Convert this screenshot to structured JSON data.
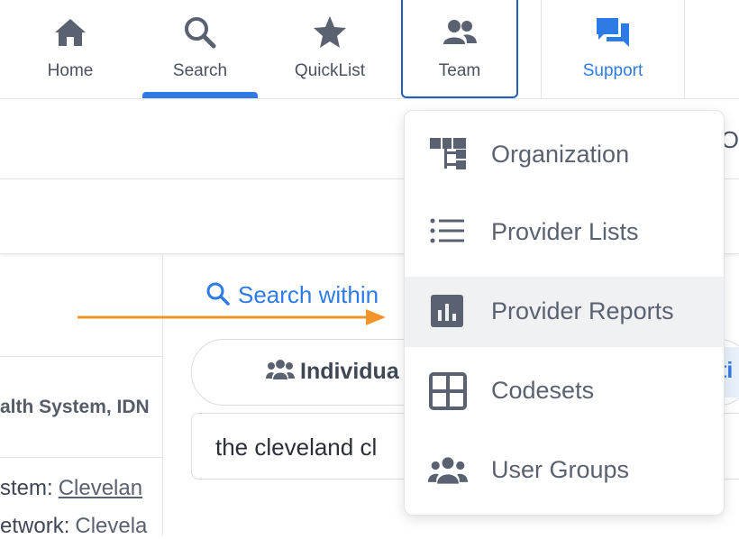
{
  "nav": {
    "home": "Home",
    "search": "Search",
    "quicklist": "QuickList",
    "team": "Team",
    "support": "Support"
  },
  "page": {
    "cut_header": "YO",
    "left_system_type": "alth System, IDN",
    "left_row1_label": "stem:",
    "left_row1_value": "Clevelan",
    "left_row2_label": "etwork:",
    "left_row2_value": "Clevela",
    "search_within": "Search within",
    "tab_individual": "Individua",
    "tab_org_cut": "ti",
    "query_value": "the cleveland cl"
  },
  "team_menu": {
    "items": [
      {
        "label": "Organization",
        "icon": "org-chart-icon"
      },
      {
        "label": "Provider Lists",
        "icon": "list-icon"
      },
      {
        "label": "Provider Reports",
        "icon": "bar-chart-icon"
      },
      {
        "label": "Codesets",
        "icon": "grid-icon"
      },
      {
        "label": "User Groups",
        "icon": "users-icon"
      }
    ]
  },
  "colors": {
    "accent": "#2f7be6",
    "team_border": "#1f5fbf",
    "arrow": "#f0962c",
    "icon_gray": "#5a6170"
  }
}
